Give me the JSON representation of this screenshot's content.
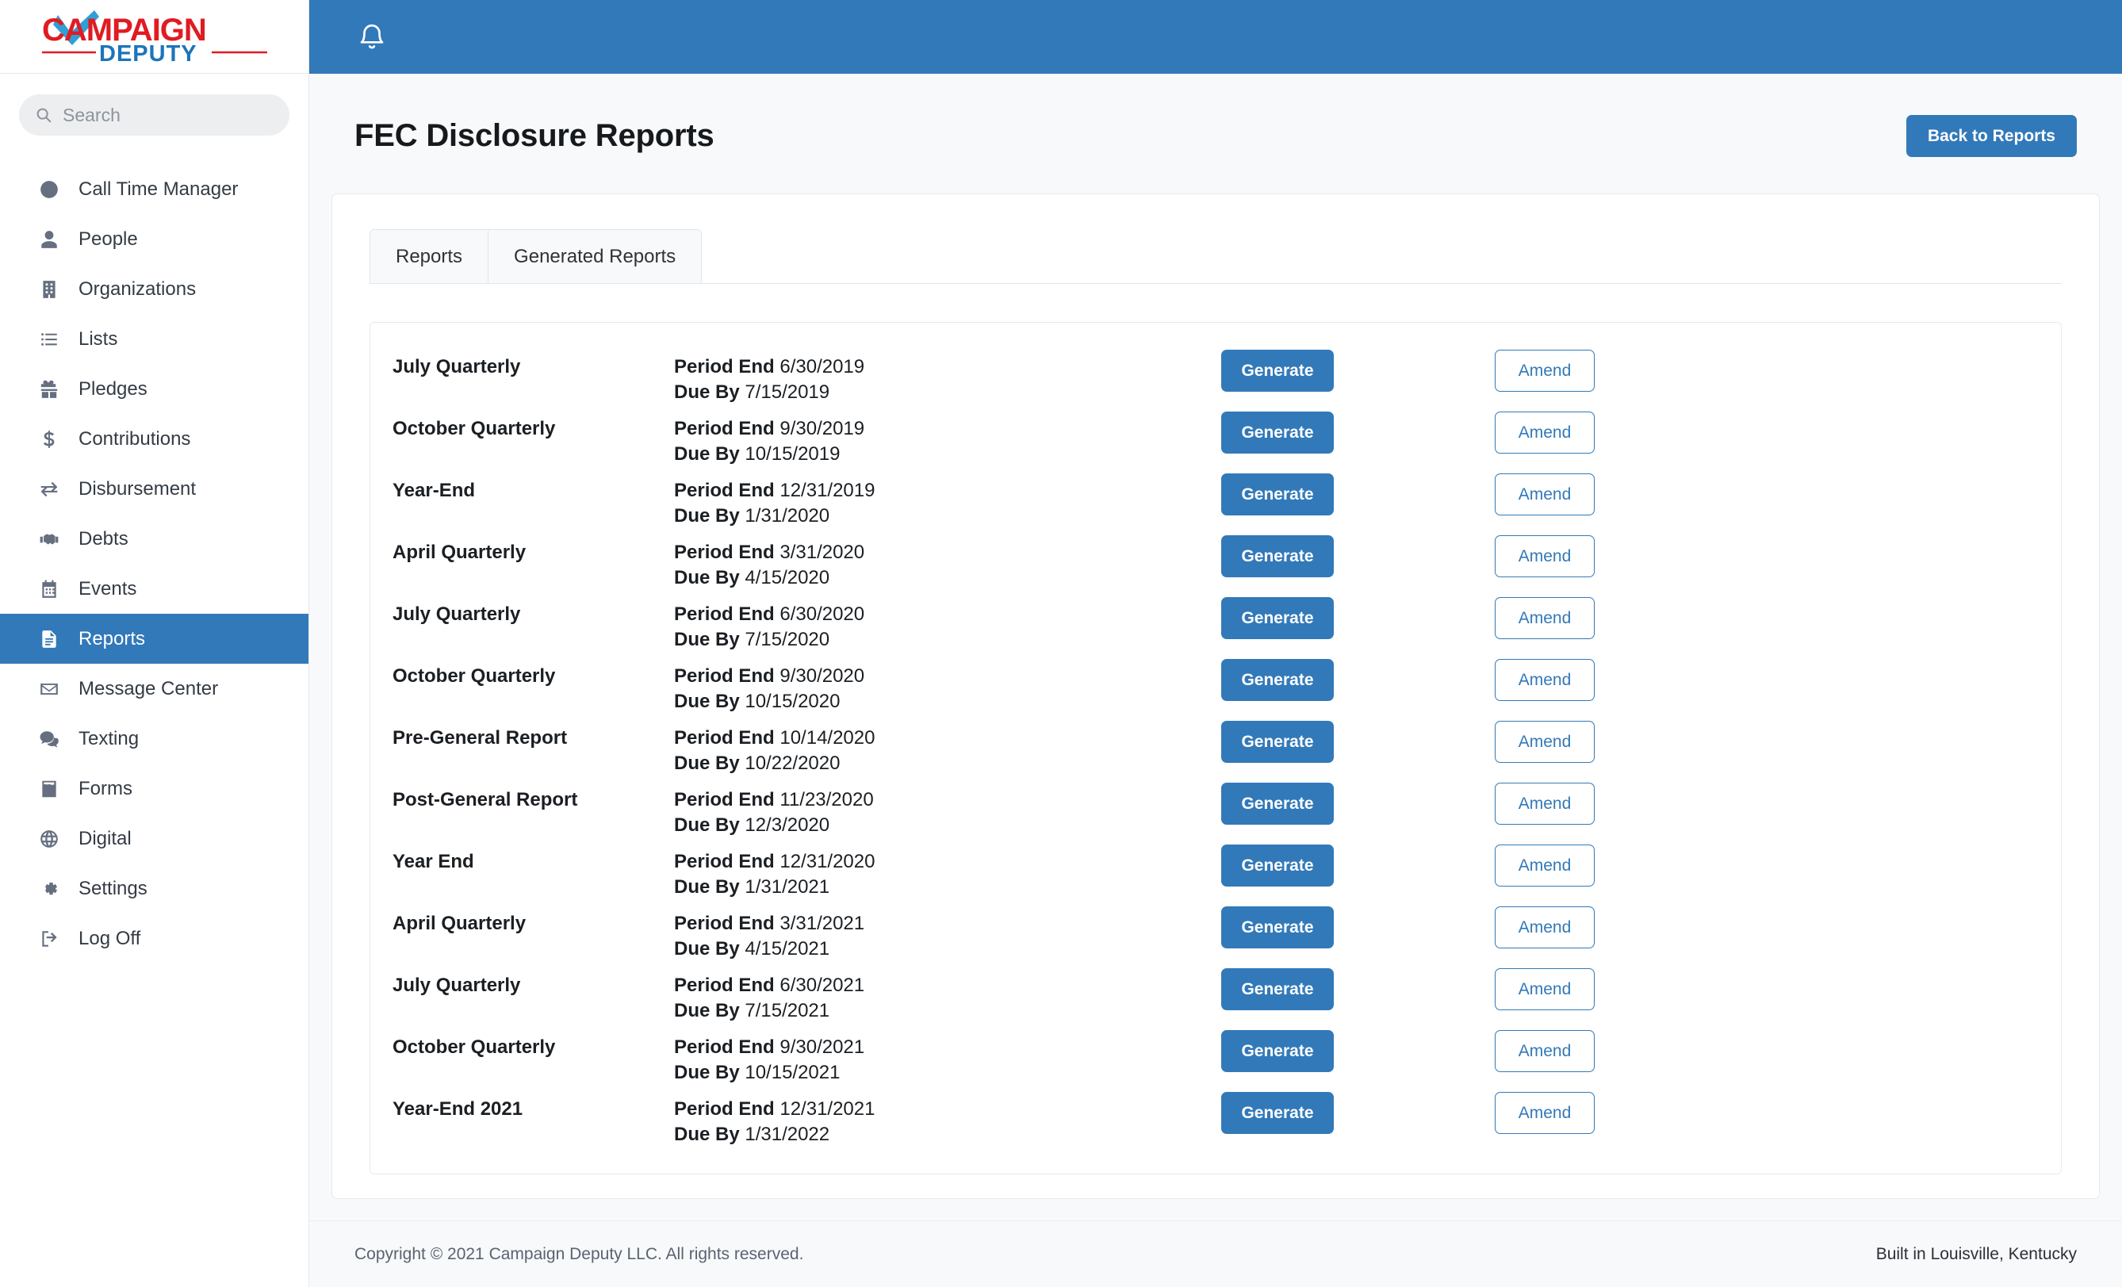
{
  "brand": {
    "line1": "CAMPAIGN",
    "line2": "DEPUTY",
    "red": "#e01b22",
    "blue": "#1b75bb"
  },
  "search": {
    "placeholder": "Search",
    "value": "",
    "icon": "search-icon"
  },
  "topbar": {
    "bell_icon": "bell-icon",
    "background": "#3279b9"
  },
  "sidebar": {
    "items": [
      {
        "label": "Call Time Manager",
        "icon": "clock-icon",
        "active": false
      },
      {
        "label": "People",
        "icon": "person-icon",
        "active": false
      },
      {
        "label": "Organizations",
        "icon": "building-icon",
        "active": false
      },
      {
        "label": "Lists",
        "icon": "list-icon",
        "active": false
      },
      {
        "label": "Pledges",
        "icon": "gift-icon",
        "active": false
      },
      {
        "label": "Contributions",
        "icon": "dollar-icon",
        "active": false
      },
      {
        "label": "Disbursement",
        "icon": "exchange-icon",
        "active": false
      },
      {
        "label": "Debts",
        "icon": "handshake-icon",
        "active": false
      },
      {
        "label": "Events",
        "icon": "calendar-icon",
        "active": false
      },
      {
        "label": "Reports",
        "icon": "document-icon",
        "active": true
      },
      {
        "label": "Message Center",
        "icon": "envelope-icon",
        "active": false
      },
      {
        "label": "Texting",
        "icon": "chat-icon",
        "active": false
      },
      {
        "label": "Forms",
        "icon": "form-icon",
        "active": false
      },
      {
        "label": "Digital",
        "icon": "globe-icon",
        "active": false
      },
      {
        "label": "Settings",
        "icon": "gear-icon",
        "active": false
      },
      {
        "label": "Log Off",
        "icon": "logout-icon",
        "active": false
      }
    ]
  },
  "page": {
    "title": "FEC Disclosure Reports",
    "back_button": "Back to Reports",
    "accent_color": "#3279b9"
  },
  "tabs": [
    {
      "label": "Reports",
      "active": true
    },
    {
      "label": "Generated Reports",
      "active": false
    }
  ],
  "labels": {
    "period_end": "Period End",
    "due_by": "Due By",
    "generate": "Generate",
    "amend": "Amend"
  },
  "reports": [
    {
      "name": "July Quarterly",
      "period_end": "6/30/2019",
      "due_by": "7/15/2019"
    },
    {
      "name": "October Quarterly",
      "period_end": "9/30/2019",
      "due_by": "10/15/2019"
    },
    {
      "name": "Year-End",
      "period_end": "12/31/2019",
      "due_by": "1/31/2020"
    },
    {
      "name": "April Quarterly",
      "period_end": "3/31/2020",
      "due_by": "4/15/2020"
    },
    {
      "name": "July Quarterly",
      "period_end": "6/30/2020",
      "due_by": "7/15/2020"
    },
    {
      "name": "October Quarterly",
      "period_end": "9/30/2020",
      "due_by": "10/15/2020"
    },
    {
      "name": "Pre-General Report",
      "period_end": "10/14/2020",
      "due_by": "10/22/2020"
    },
    {
      "name": "Post-General Report",
      "period_end": "11/23/2020",
      "due_by": "12/3/2020"
    },
    {
      "name": "Year End",
      "period_end": "12/31/2020",
      "due_by": "1/31/2021"
    },
    {
      "name": "April Quarterly",
      "period_end": "3/31/2021",
      "due_by": "4/15/2021"
    },
    {
      "name": "July Quarterly",
      "period_end": "6/30/2021",
      "due_by": "7/15/2021"
    },
    {
      "name": "October Quarterly",
      "period_end": "9/30/2021",
      "due_by": "10/15/2021"
    },
    {
      "name": "Year-End 2021",
      "period_end": "12/31/2021",
      "due_by": "1/31/2022"
    }
  ],
  "footer": {
    "left": "Copyright © 2021 Campaign Deputy LLC. All rights reserved.",
    "right": "Built in Louisville, Kentucky"
  }
}
